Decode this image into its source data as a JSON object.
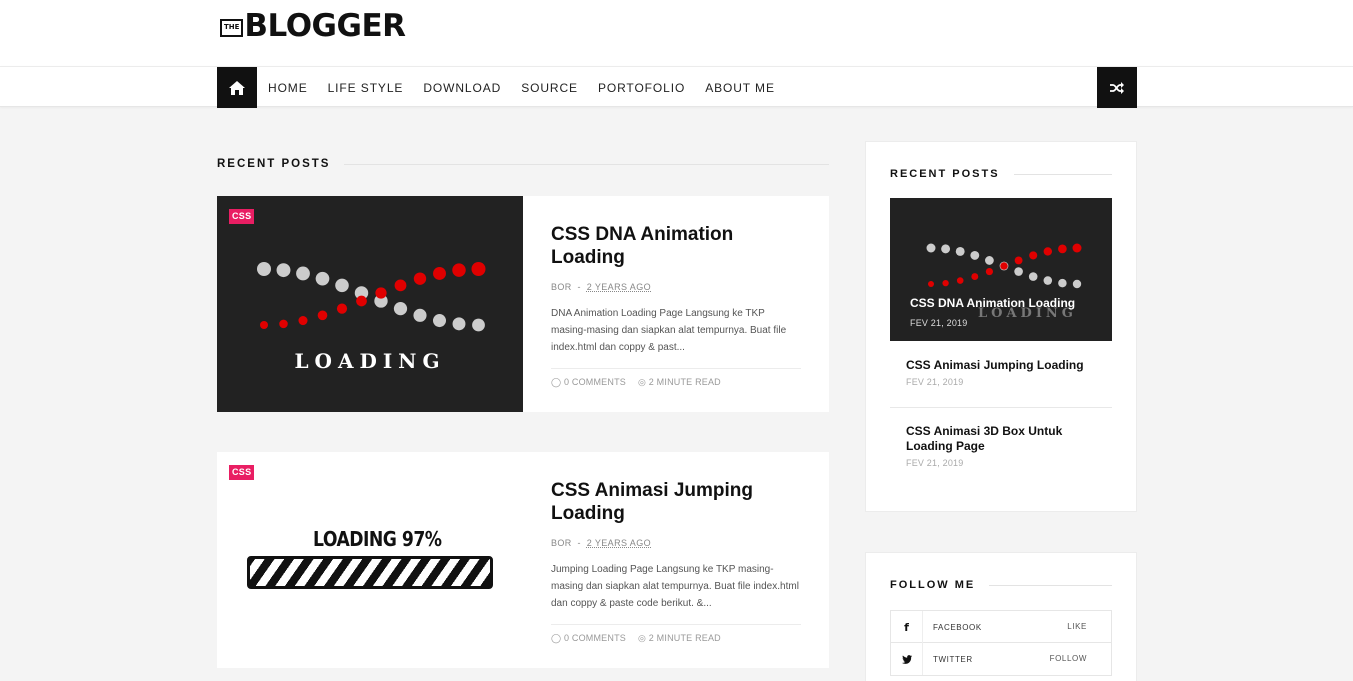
{
  "header": {
    "logo_small": "THE",
    "logo_text": "BLOGGER"
  },
  "nav": {
    "home_icon": "home-icon",
    "items": [
      {
        "label": "HOME"
      },
      {
        "label": "LIFE STYLE"
      },
      {
        "label": "DOWNLOAD"
      },
      {
        "label": "SOURCE"
      },
      {
        "label": "PORTOFOLIO"
      },
      {
        "label": "ABOUT ME"
      }
    ],
    "shuffle_icon": "shuffle-icon"
  },
  "main": {
    "heading": "RECENT POSTS",
    "posts": [
      {
        "category": "CSS",
        "title": "CSS DNA Animation Loading",
        "author": "BOR",
        "separator": "-",
        "date": "2 YEARS AGO",
        "excerpt": "DNA Animation Loading Page Langsung ke TKP masing-masing dan siapkan alat tempurnya. Buat file  index.html  dan coppy & past...",
        "comments": "0 COMMENTS",
        "read_time": "2 MINUTE  READ",
        "thumb_text": "LOADING"
      },
      {
        "category": "CSS",
        "title": "CSS Animasi Jumping Loading",
        "author": "BOR",
        "separator": "-",
        "date": "2 YEARS AGO",
        "excerpt": "Jumping Loading Page Langsung ke TKP masing-masing dan siapkan alat tempurnya. Buat file index.html dan coppy & paste code berikut. &...",
        "comments": "0 COMMENTS",
        "read_time": "2 MINUTE  READ",
        "thumb_text": "LOADING 97%"
      }
    ]
  },
  "sidebar": {
    "recent": {
      "heading": "RECENT POSTS",
      "featured": {
        "title": "CSS DNA Animation Loading",
        "date": "FEV 21, 2019"
      },
      "items": [
        {
          "title": "CSS Animasi Jumping Loading",
          "date": "FEV 21, 2019"
        },
        {
          "title": "CSS Animasi 3D Box Untuk Loading Page",
          "date": "FEV 21, 2019"
        }
      ]
    },
    "follow": {
      "heading": "FOLLOW ME",
      "items": [
        {
          "icon": "f",
          "name": "FACEBOOK",
          "action": "LIKE"
        },
        {
          "icon": "t",
          "name": "TWITTER",
          "action": "FOLLOW"
        }
      ]
    }
  },
  "colors": {
    "accent": "#e91e63",
    "dark": "#111111",
    "dna_red": "#e00000",
    "dna_grey": "#cccccc"
  }
}
